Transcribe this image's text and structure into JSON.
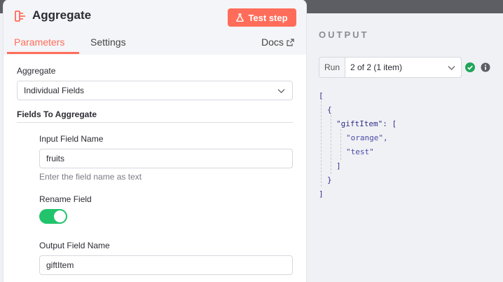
{
  "node": {
    "title": "Aggregate",
    "test_button": "Test step",
    "tabs": [
      "Parameters",
      "Settings"
    ],
    "docs_label": "Docs"
  },
  "params": {
    "aggregate_label": "Aggregate",
    "aggregate_value": "Individual Fields",
    "fields_section": "Fields To Aggregate",
    "input_field_label": "Input Field Name",
    "input_field_value": "fruits",
    "input_field_hint": "Enter the field name as text",
    "rename_label": "Rename Field",
    "rename_enabled": true,
    "output_field_label": "Output Field Name",
    "output_field_value": "giftItem"
  },
  "output": {
    "title": "OUTPUT",
    "run_label": "Run",
    "run_value": "2 of 2 (1 item)",
    "json_lines": [
      "[",
      "{",
      "\"giftItem\": [",
      "\"orange\",",
      "\"test\"",
      "]",
      "}",
      "]"
    ]
  },
  "colors": {
    "accent": "#ff6d5a",
    "toggle_on": "#21c36b",
    "success": "#21a55a"
  }
}
